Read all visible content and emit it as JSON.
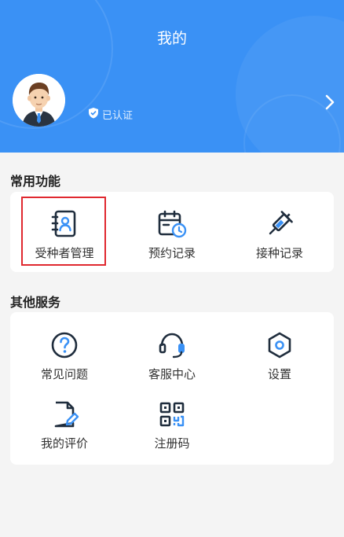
{
  "header": {
    "title": "我的",
    "verified_text": "已认证",
    "background_color": "#3a91f5"
  },
  "common_functions": {
    "title": "常用功能",
    "items": [
      {
        "label": "受种者管理",
        "icon": "recipient-profile-icon",
        "highlighted": true
      },
      {
        "label": "预约记录",
        "icon": "calendar-clock-icon"
      },
      {
        "label": "接种记录",
        "icon": "syringe-icon"
      }
    ]
  },
  "other_services": {
    "title": "其他服务",
    "items": [
      {
        "label": "常见问题",
        "icon": "question-icon"
      },
      {
        "label": "客服中心",
        "icon": "headset-icon"
      },
      {
        "label": "设置",
        "icon": "settings-hex-icon"
      },
      {
        "label": "我的评价",
        "icon": "document-edit-icon"
      },
      {
        "label": "注册码",
        "icon": "qr-code-icon"
      }
    ]
  },
  "colors": {
    "accent": "#3a91f5",
    "icon_dark": "#1f2d3d",
    "highlight_border": "#e0282f"
  }
}
